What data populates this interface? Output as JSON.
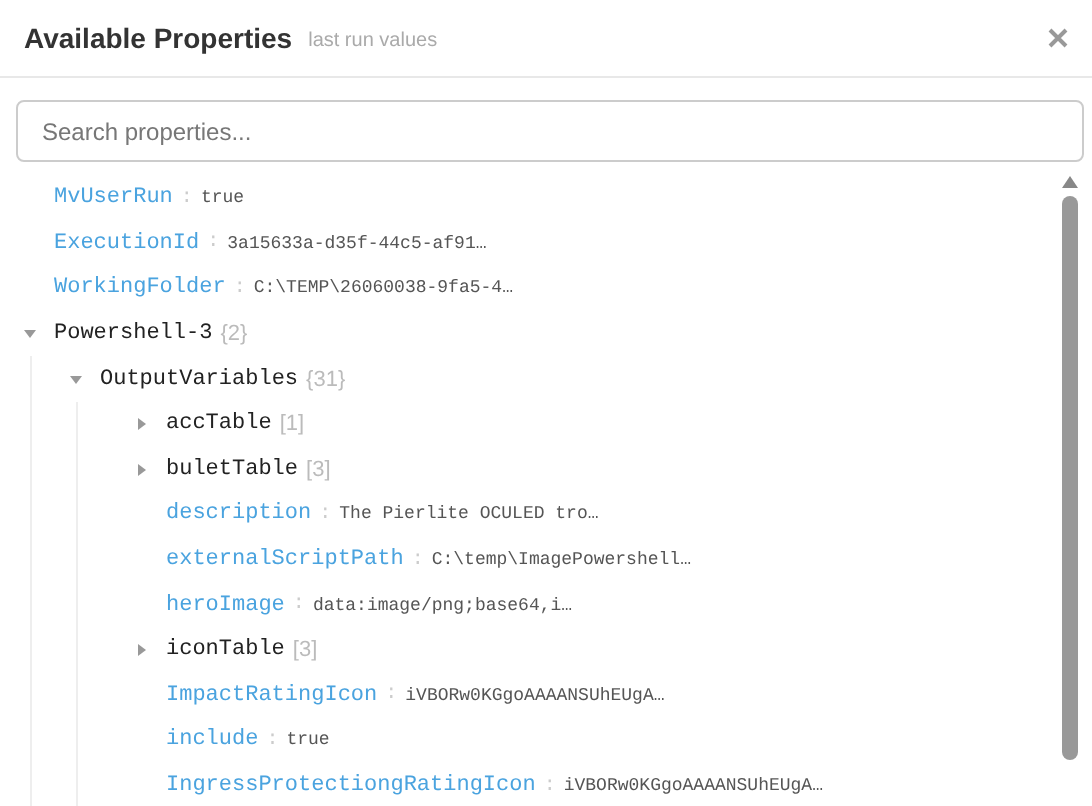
{
  "header": {
    "title": "Available Properties",
    "subtitle": "last run values"
  },
  "search": {
    "placeholder": "Search properties..."
  },
  "tree": [
    {
      "kind": "leaf",
      "key": "MvUserRun",
      "sep": ":",
      "value": "true"
    },
    {
      "kind": "leaf",
      "key": "ExecutionId",
      "sep": ":",
      "value": "3a15633a-d35f-44c5-af91…"
    },
    {
      "kind": "leaf",
      "key": "WorkingFolder",
      "sep": ":",
      "value": "C:\\TEMP\\26060038-9fa5-4…"
    },
    {
      "kind": "node",
      "name": "Powershell-3",
      "count": "{2}",
      "expanded": true,
      "children": [
        {
          "kind": "node",
          "name": "OutputVariables",
          "count": "{31}",
          "expanded": true,
          "children": [
            {
              "kind": "node",
              "name": "accTable",
              "count": "[1]",
              "expanded": false
            },
            {
              "kind": "node",
              "name": "buletTable",
              "count": "[3]",
              "expanded": false
            },
            {
              "kind": "leaf",
              "key": "description",
              "sep": ":",
              "value": "The Pierlite OCULED tro…"
            },
            {
              "kind": "leaf",
              "key": "externalScriptPath",
              "sep": ":",
              "value": "C:\\temp\\ImagePowershell…"
            },
            {
              "kind": "leaf",
              "key": "heroImage",
              "sep": ":",
              "value": "data:image/png;base64,i…"
            },
            {
              "kind": "node",
              "name": "iconTable",
              "count": "[3]",
              "expanded": false
            },
            {
              "kind": "leaf",
              "key": "ImpactRatingIcon",
              "sep": ":",
              "value": "iVBORw0KGgoAAAANSUhEUgA…"
            },
            {
              "kind": "leaf",
              "key": "include",
              "sep": ":",
              "value": "true"
            },
            {
              "kind": "leaf",
              "key": "IngressProtectiongRatingIcon",
              "sep": ":",
              "value": "iVBORw0KGgoAAAANSUhEUgA…"
            }
          ]
        }
      ]
    }
  ]
}
